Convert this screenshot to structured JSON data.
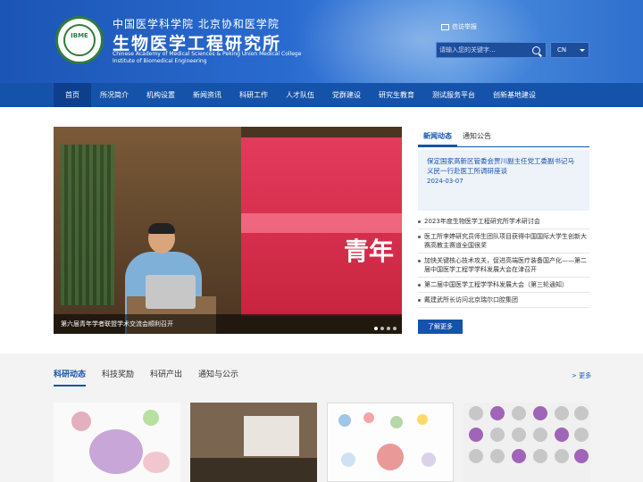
{
  "header": {
    "school_cn": "中国医学科学院 北京协和医学院",
    "institute_cn": "生物医学工程研究所",
    "institute_en_1": "Chinese Academy of Medical Sciences & Peking Union Medical College",
    "institute_en_2": "Institute of Biomedical Engineering",
    "logo_text": "IBME",
    "mail_label": "信访举报",
    "search_placeholder": "请输入您的关键字...",
    "lang": "CN"
  },
  "nav": [
    {
      "label": "首页",
      "active": true
    },
    {
      "label": "所况简介"
    },
    {
      "label": "机构设置"
    },
    {
      "label": "新闻资讯"
    },
    {
      "label": "科研工作"
    },
    {
      "label": "人才队伍"
    },
    {
      "label": "党群建设"
    },
    {
      "label": "研究生教育"
    },
    {
      "label": "测试服务平台"
    },
    {
      "label": "创新基地建设"
    }
  ],
  "banner": {
    "screen_text": "青年",
    "caption": "第六届青年学者联盟学术交流会顺利召开"
  },
  "news": {
    "tabs": [
      "新闻动态",
      "通知公告"
    ],
    "featured": {
      "title": "保定国家高新区管委会贾川副主任党工委副书记马义民一行赴医工所调研座谈",
      "date": "2024-03-07"
    },
    "items": [
      "2023年度生物医学工程研究所学术研讨会",
      "医工所李婷研究员师生团队项目获得中国国际大学生创新大赛高教主赛道全国很奖",
      "加快关键核心技术攻关，促进高端医疗装备国产化——第二届中国医学工程学学科发展大会在津召开",
      "第二届中国医学工程学学科发展大会（第三轮通知）",
      "戴建武所长访问北京瑞尔口腔集团"
    ],
    "more_button": "了解更多"
  },
  "research": {
    "tabs": [
      "科研动态",
      "科技奖励",
      "科研产出",
      "通知与公示"
    ],
    "more": "> 更多"
  },
  "colors": {
    "primary": "#1553ab",
    "nav_active": "#0e3f8c",
    "header_blue": "#2a6bd0"
  }
}
